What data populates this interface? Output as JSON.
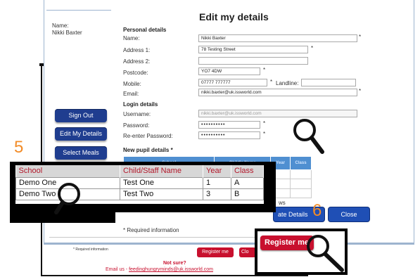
{
  "page": {
    "heading": "Edit my details",
    "name_label": "Name:",
    "name_value": "Nikki Baxter",
    "required_note": "* Required information"
  },
  "personal": {
    "title": "Personal details",
    "name_label": "Name:",
    "name_value": "Nikki Baxter",
    "address1_label": "Address 1:",
    "address1_value": "78 Testing Street",
    "address2_label": "Address 2:",
    "address2_value": "",
    "postcode_label": "Postcode:",
    "postcode_value": "YO7 4DW",
    "mobile_label": "Mobile:",
    "mobile_value": "07777 777777",
    "landline_label": "Landline:",
    "landline_value": "",
    "email_label": "Email:",
    "email_value": "nikki.baxter@uk.issworld.com"
  },
  "login": {
    "title": "Login details",
    "username_label": "Username:",
    "username_value": "nikki.baxter@uk.issworld.com",
    "password_label": "Password:",
    "password_value": "••••••••••",
    "reenter_label": "Re-enter Password:",
    "reenter_value": "••••••••••"
  },
  "pupils": {
    "title": "New pupil details *",
    "small_headers": [
      "School",
      "Child's Name",
      "Year",
      "Class"
    ],
    "headers": [
      "School",
      "Child/Staff Name",
      "Year",
      "Class"
    ],
    "rows": [
      [
        "Demo One",
        "Test One",
        "1",
        "A"
      ],
      [
        "Demo Two",
        "Test Two",
        "3",
        "B"
      ]
    ]
  },
  "nav": {
    "sign_out": "Sign Out",
    "edit_details": "Edit My Details",
    "select_meals": "Select Meals"
  },
  "actions": {
    "update_details": "ate Details",
    "close": "Close",
    "partial_text": "ws"
  },
  "background_form": {
    "required_note": "* Required information",
    "register_label": "Register me",
    "close_partial": "Clo",
    "not_sure": "Not sure?",
    "email_prefix": "Email us - ",
    "email_link": "feedinghungryminds@uk.issworld.com"
  },
  "callout": {
    "register_label": "Register me"
  },
  "steps": {
    "five": "5",
    "six": "6"
  },
  "colors": {
    "nav_blue": "#1f3d8f",
    "brand_red": "#c8102e",
    "step_orange": "#f28c28",
    "table_header_blue": "#4f8fd1"
  },
  "icons": [
    "magnifier-icon"
  ]
}
